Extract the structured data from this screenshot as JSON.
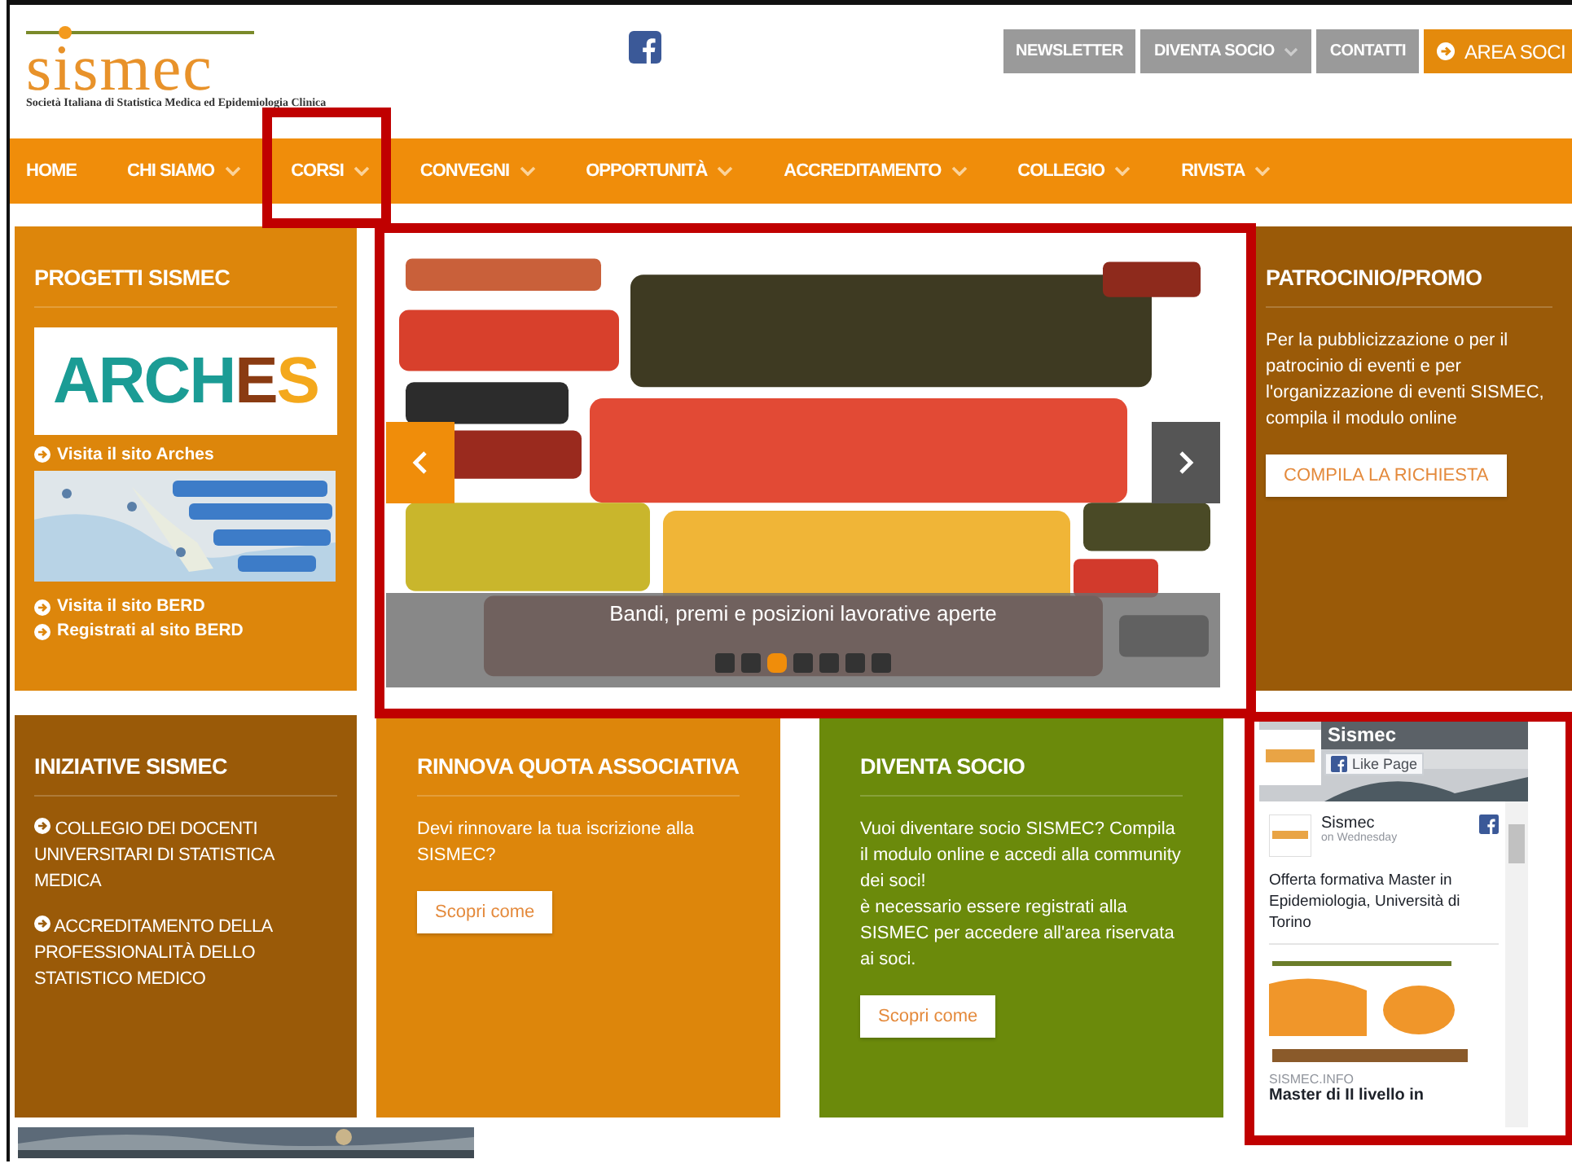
{
  "logo": {
    "name": "sismec",
    "tagline": "Società Italiana di Statistica Medica ed Epidemiologia Clinica"
  },
  "top_links": [
    {
      "label": "NEWSLETTER",
      "kind": "grey",
      "has_dropdown": false
    },
    {
      "label": "DIVENTA SOCIO",
      "kind": "grey",
      "has_dropdown": true
    },
    {
      "label": "CONTATTI",
      "kind": "grey",
      "has_dropdown": false
    },
    {
      "label": "AREA SOCI",
      "kind": "accent",
      "has_dropdown": false
    }
  ],
  "nav": [
    {
      "label": "HOME",
      "has_dropdown": false
    },
    {
      "label": "CHI SIAMO",
      "has_dropdown": true
    },
    {
      "label": "CORSI",
      "has_dropdown": true
    },
    {
      "label": "CONVEGNI",
      "has_dropdown": true
    },
    {
      "label": "OPPORTUNITÀ",
      "has_dropdown": true
    },
    {
      "label": "ACCREDITAMENTO",
      "has_dropdown": true
    },
    {
      "label": "COLLEGIO",
      "has_dropdown": true
    },
    {
      "label": "RIVISTA",
      "has_dropdown": true
    }
  ],
  "progetti": {
    "title": "PROGETTI SISMEC",
    "logo_letters": [
      {
        "text": "ARCH",
        "color": "#1b9c95"
      },
      {
        "text": "E",
        "color": "#8a3b12"
      },
      {
        "text": "S",
        "color": "#f4a81c"
      }
    ],
    "arches_link": "Visita il sito Arches",
    "berd_links": [
      "Visita il sito BERD",
      "Registrati al sito BERD"
    ]
  },
  "slider": {
    "caption": "Bandi, premi e posizioni lavorative aperte",
    "dots": [
      {
        "selected": false
      },
      {
        "selected": false
      },
      {
        "selected": true
      },
      {
        "selected": false
      },
      {
        "selected": false
      },
      {
        "selected": false
      },
      {
        "selected": false
      }
    ]
  },
  "patrocinio": {
    "title": "PATROCINIO/PROMO",
    "text": "Per la pubblicizzazione o per il patrocinio di eventi e per l'organizzazione di eventi SISMEC, compila il modulo online",
    "button": "COMPILA LA RICHIESTA"
  },
  "iniziative": {
    "title": "INIZIATIVE SISMEC",
    "links": [
      "COLLEGIO DEI DOCENTI UNIVERSITARI DI STATISTICA MEDICA",
      "ACCREDITAMENTO DELLA PROFESSIONALITÀ DELLO STATISTICO MEDICO"
    ]
  },
  "rinnova": {
    "title": "RINNOVA QUOTA ASSOCIATIVA",
    "text": "Devi rinnovare la tua iscrizione alla SISMEC?",
    "button": "Scopri come"
  },
  "diventa": {
    "title": "DIVENTA SOCIO",
    "paragraphs": [
      "Vuoi diventare socio SISMEC? Compila il modulo online e accedi alla community dei soci!",
      "è necessario essere registrati alla SISMEC per accedere all'area riservata ai soci."
    ],
    "button": "Scopri come"
  },
  "facebook": {
    "page_name": "Sismec",
    "like_button": "Like Page",
    "post": {
      "author": "Sismec",
      "time": "on Wednesday",
      "text": "Offerta formativa Master in Epidemiologia, Università di Torino",
      "link_domain": "SISMEC.INFO",
      "link_title": "Master di II livello in"
    }
  }
}
